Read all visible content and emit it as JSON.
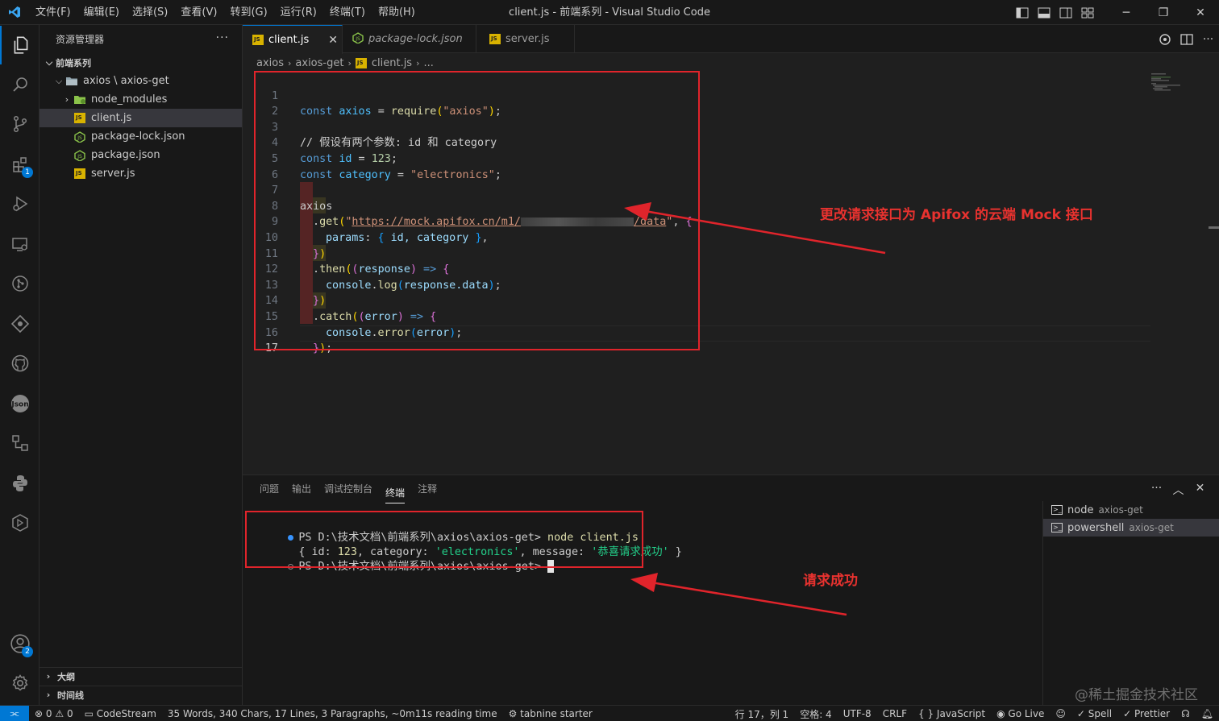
{
  "window": {
    "title": "client.js - 前端系列 - Visual Studio Code",
    "menu": [
      "文件(F)",
      "编辑(E)",
      "选择(S)",
      "查看(V)",
      "转到(G)",
      "运行(R)",
      "终端(T)",
      "帮助(H)"
    ]
  },
  "colors": {
    "accent": "#0078d4",
    "annotation": "#e0242b",
    "js_icon": "#d8b200"
  },
  "activity_bar": {
    "items": [
      "explorer-icon",
      "search-icon",
      "source-control-icon",
      "extensions-icon",
      "run-debug-icon",
      "remote-explorer-icon",
      "git-graph-icon",
      "gitlens-icon",
      "github-icon",
      "json-icon",
      "tree-icon",
      "python-icon",
      "package-icon"
    ],
    "extensions_badge": "1",
    "accounts_badge": "2"
  },
  "sidebar": {
    "title": "资源管理器",
    "root": "前端系列",
    "folder": "axios \\ axios-get",
    "items": [
      {
        "label": "node_modules",
        "type": "folder"
      },
      {
        "label": "client.js",
        "type": "js"
      },
      {
        "label": "package-lock.json",
        "type": "json"
      },
      {
        "label": "package.json",
        "type": "json"
      },
      {
        "label": "server.js",
        "type": "js"
      }
    ],
    "outline": "大纲",
    "timeline": "时间线"
  },
  "tabs": [
    {
      "label": "client.js",
      "active": true
    },
    {
      "label": "package-lock.json",
      "active": false
    },
    {
      "label": "server.js",
      "active": false
    }
  ],
  "breadcrumb": [
    "axios",
    "axios-get",
    "client.js",
    "..."
  ],
  "code": {
    "line_numbers": [
      "1",
      "2",
      "3",
      "4",
      "5",
      "6",
      "7",
      "8",
      "9",
      "10",
      "11",
      "12",
      "13",
      "14",
      "15",
      "16",
      "17"
    ],
    "l1": {
      "kw": "const",
      "var": "axios",
      "eq": " = ",
      "fn": "require",
      "open": "(",
      "str": "\"axios\"",
      "close": ")",
      "end": ";"
    },
    "l3": "// 假设有两个参数: id 和 category",
    "l4": {
      "kw": "const",
      "var": "id",
      "eq": " = ",
      "num": "123",
      "end": ";"
    },
    "l5": {
      "kw": "const",
      "var": "category",
      "eq": " = ",
      "str": "\"electronics\"",
      "end": ";"
    },
    "l7": "axios",
    "l8": {
      "dot": ".",
      "fn": "get",
      "open": "(",
      "q1": "\"",
      "url": "https://mock.apifox.cn/m1/",
      "url_end": "/data",
      "q2": "\"",
      "rest": ", ",
      "brace": "{"
    },
    "l9": {
      "prop": "params",
      "colon": ": ",
      "open": "{",
      "body": " id, category ",
      "close": "}",
      "end": ","
    },
    "l10": {
      "brace": "}",
      "paren": ")"
    },
    "l11": {
      "dot": ".",
      "fn": "then",
      "open": "(",
      "p_open": "(",
      "param": "response",
      "p_close": ")",
      "arrow": " => ",
      "brace": "{"
    },
    "l12": {
      "obj": "console",
      "dot": ".",
      "fn": "log",
      "open": "(",
      "arg": "response.data",
      "close": ")",
      "end": ";"
    },
    "l13": {
      "brace": "}",
      "paren": ")"
    },
    "l14": {
      "dot": ".",
      "fn": "catch",
      "open": "(",
      "p_open": "(",
      "param": "error",
      "p_close": ")",
      "arrow": " => ",
      "brace": "{"
    },
    "l15": {
      "obj": "console",
      "dot": ".",
      "fn": "error",
      "open": "(",
      "arg": "error",
      "close": ")",
      "end": ";"
    },
    "l16": {
      "brace": "}",
      "paren": ")",
      "end": ";"
    }
  },
  "annotations": {
    "editor_note": "更改请求接口为 Apifox 的云端 Mock 接口",
    "terminal_note": "请求成功"
  },
  "panel": {
    "tabs": [
      "问题",
      "输出",
      "调试控制台",
      "终端",
      "注释"
    ],
    "active_tab": "终端",
    "terminal": {
      "prompt": "PS D:\\技术文档\\前端系列\\axios\\axios-get> ",
      "command": "node client.js",
      "out_open": "{ id: ",
      "out_id": "123",
      "out_mid": ", category: ",
      "out_cat": "'electronics'",
      "out_mid2": ", message: ",
      "out_msg": "'恭喜请求成功'",
      "out_close": " }"
    },
    "terminal_list": [
      {
        "name": "node",
        "cwd": "axios-get"
      },
      {
        "name": "powershell",
        "cwd": "axios-get"
      }
    ],
    "watermark": "@稀土掘金技术社区"
  },
  "statusbar": {
    "errors": "0",
    "warnings": "0",
    "codestream": "CodeStream",
    "stats": "35 Words, 340 Chars, 17 Lines, 3 Paragraphs, ~0m11s reading time",
    "tabnine": "tabnine starter",
    "position": "行 17，列 1",
    "spaces": "空格: 4",
    "encoding": "UTF-8",
    "eol": "CRLF",
    "language": "JavaScript",
    "golive": "Go Live",
    "spell": "Spell",
    "prettier": "Prettier"
  }
}
